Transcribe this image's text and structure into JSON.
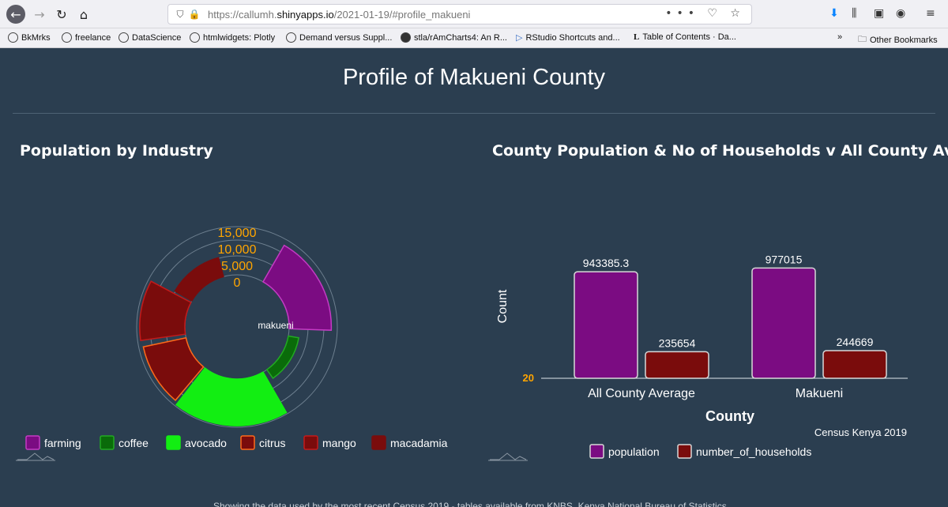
{
  "browser": {
    "url_prefix": "https://callumh.",
    "url_host": "shinyapps.io",
    "url_path": "/2021-01-19/#profile_makueni",
    "url_more": "•••"
  },
  "bookmarks": [
    {
      "label": "BkMrks"
    },
    {
      "label": "freelance"
    },
    {
      "label": "DataScience"
    },
    {
      "label": "htmlwidgets: Plotly"
    },
    {
      "label": "Demand versus Suppl..."
    },
    {
      "label": "stla/rAmCharts4: An R..."
    },
    {
      "label": "RStudio Shortcuts and..."
    },
    {
      "label": "Table of Contents · Da..."
    }
  ],
  "other_bookmarks": "Other Bookmarks",
  "page": {
    "title": "Profile of Makueni County",
    "left_panel_title": "Population by Industry",
    "right_panel_title": "County Population & No of Households v All County Ave",
    "footer_text": "Showing the data used by the most recent Census 2019 - tables available from KNBS, Kenya National Bureau of Statistics"
  },
  "chart_data": [
    {
      "type": "radial-bar",
      "title": "Population by Industry",
      "center_label": "makueni",
      "radial_axis_ticks": [
        "15,000",
        "10,000",
        "5,000",
        "0"
      ],
      "categories": [
        "farming",
        "coffee",
        "avocado",
        "citrus",
        "mango",
        "macadamia"
      ],
      "colors": [
        "#7b0c82",
        "#0a6b0a",
        "#12ee12",
        "#7a0c0c",
        "#7a0c0c",
        "#7a0c0c"
      ],
      "legend_borders": [
        "#c43bc4",
        "#22aa22",
        "#12ee12",
        "#ff6a1a",
        "#c41a1a",
        "#7a0c0c"
      ],
      "values": [
        14000,
        3500,
        15500,
        14500,
        15000,
        6500
      ]
    },
    {
      "type": "bar",
      "title": "County Population & No of Households v All County Ave",
      "categories": [
        "All County Average",
        "Makueni"
      ],
      "xlabel": "County",
      "ylabel": "Count",
      "series": [
        {
          "name": "population",
          "color": "#7b0c82",
          "values": [
            943385.3,
            977015
          ]
        },
        {
          "name": "number_of_households",
          "color": "#7a0c0c",
          "values": [
            235654,
            244669
          ]
        }
      ],
      "value_labels": [
        [
          "943385.3",
          "977015"
        ],
        [
          "235654",
          "244669"
        ]
      ],
      "axis_tick_overlap": "20",
      "ylim": [
        0,
        1000000
      ],
      "credit": "Census Kenya 2019"
    }
  ]
}
